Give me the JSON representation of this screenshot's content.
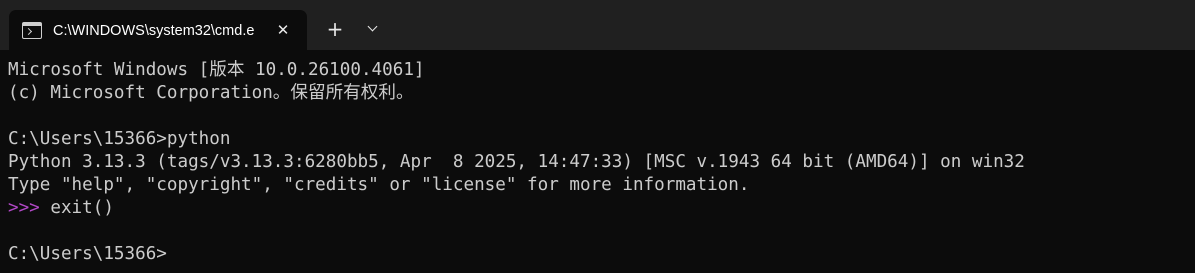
{
  "window": {
    "tab_title": "C:\\WINDOWS\\system32\\cmd.e",
    "tab_close": "✕",
    "new_tab": "+"
  },
  "terminal": {
    "lines": [
      "Microsoft Windows [版本 10.0.26100.4061]",
      "(c) Microsoft Corporation。保留所有权利。",
      "",
      "C:\\Users\\15366>python",
      "Python 3.13.3 (tags/v3.13.3:6280bb5, Apr  8 2025, 14:47:33) [MSC v.1943 64 bit (AMD64)] on win32",
      "Type \"help\", \"copyright\", \"credits\" or \"license\" for more information.",
      "",
      "",
      "C:\\Users\\15366>"
    ],
    "repl_prompt": ">>>",
    "repl_command": " exit()"
  },
  "colors": {
    "background": "#0c0c0c",
    "tabbar": "#202020",
    "text": "#cccccc",
    "repl_prompt": "#b148c6"
  }
}
